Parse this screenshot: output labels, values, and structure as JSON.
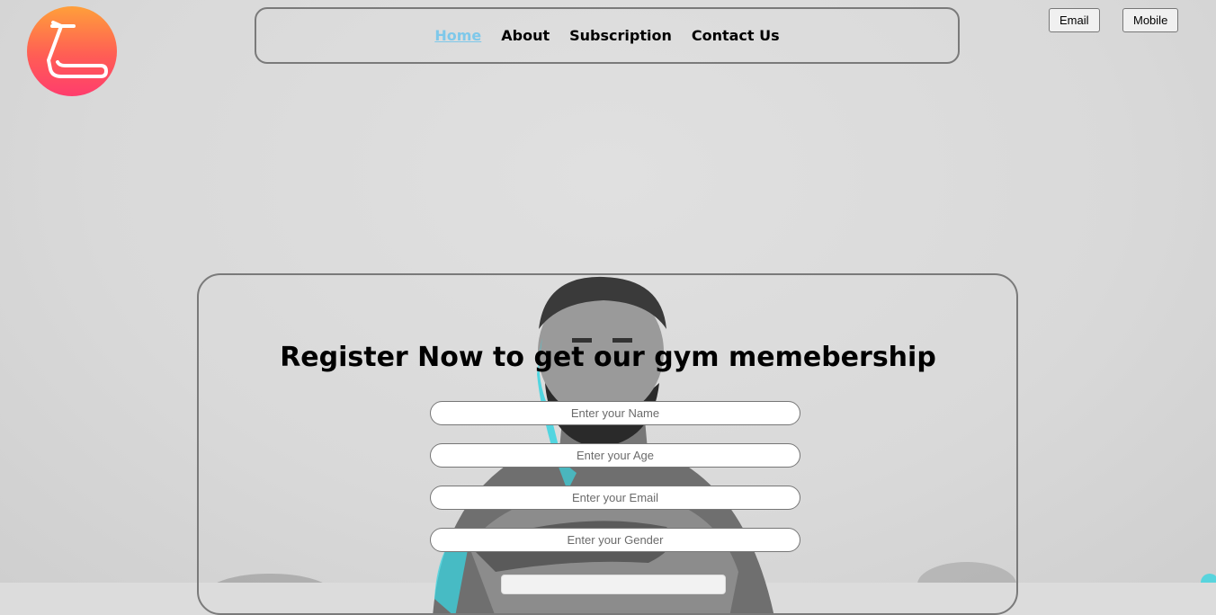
{
  "logo": {
    "icon": "treadmill-icon"
  },
  "nav": {
    "items": [
      {
        "label": "Home",
        "active": true
      },
      {
        "label": "About",
        "active": false
      },
      {
        "label": "Subscription",
        "active": false
      },
      {
        "label": "Contact Us",
        "active": false
      }
    ]
  },
  "contact_buttons": {
    "email": "Email",
    "mobile": "Mobile"
  },
  "register": {
    "title": "Register Now to get our gym memebership",
    "fields": [
      {
        "placeholder": "Enter your Name",
        "value": ""
      },
      {
        "placeholder": "Enter your Age",
        "value": ""
      },
      {
        "placeholder": "Enter your Email",
        "value": ""
      },
      {
        "placeholder": "Enter your Gender",
        "value": ""
      }
    ]
  },
  "colors": {
    "active_nav": "#7ec8ea",
    "logo_top": "#ff9f3a",
    "logo_bottom": "#ff3d6d",
    "accent_cyan": "#3ad4e0"
  }
}
